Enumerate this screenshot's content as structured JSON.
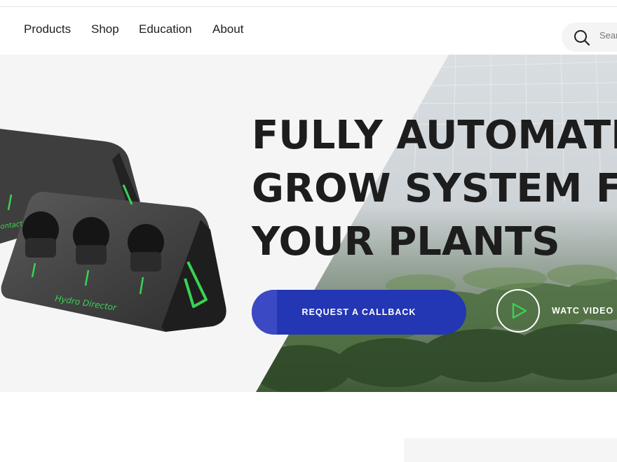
{
  "nav": {
    "items": [
      {
        "label": "Products"
      },
      {
        "label": "Shop"
      },
      {
        "label": "Education"
      },
      {
        "label": "About"
      }
    ],
    "search_placeholder": "Search"
  },
  "hero": {
    "title_lines": [
      "FULLY AUTOMATED",
      "GROW SYSTEM FOR",
      "YOUR PLANTS"
    ],
    "cta_label": "REQUEST A CALLBACK",
    "video_label": "WATC VIDEO",
    "device_label": "Hydro Director",
    "device_label_2": "Contact",
    "colors": {
      "cta": "#2336b3",
      "device_accent": "#39d353"
    }
  }
}
